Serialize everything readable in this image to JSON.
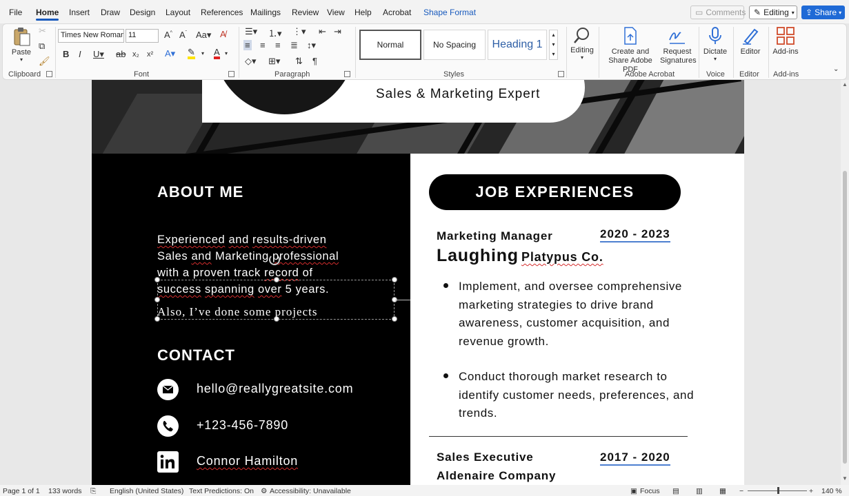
{
  "menu": {
    "tabs": [
      "File",
      "Home",
      "Insert",
      "Draw",
      "Design",
      "Layout",
      "References",
      "Mailings",
      "Review",
      "View",
      "Help",
      "Acrobat",
      "Shape Format"
    ],
    "active_tab": "Home",
    "comments_label": "Comments",
    "editing_label": "Editing",
    "share_label": "Share"
  },
  "ribbon": {
    "clipboard": {
      "paste_label": "Paste",
      "group_label": "Clipboard"
    },
    "font": {
      "font_name": "Times New Roman",
      "font_size": "11",
      "group_label": "Font"
    },
    "paragraph": {
      "group_label": "Paragraph"
    },
    "styles": {
      "normal": "Normal",
      "no_spacing": "No Spacing",
      "heading1": "Heading 1",
      "group_label": "Styles"
    },
    "editing_label": "Editing",
    "acrobat": {
      "create_share": "Create and Share Adobe PDF",
      "request_signatures": "Request Signatures",
      "group_label": "Adobe Acrobat"
    },
    "voice": {
      "dictate": "Dictate",
      "group_label": "Voice"
    },
    "editor": {
      "editor": "Editor",
      "group_label": "Editor"
    },
    "addins": {
      "addins": "Add-ins",
      "group_label": "Add-ins"
    }
  },
  "resume": {
    "subtitle": "Sales & Marketing Expert",
    "about_title": "ABOUT ME",
    "about_words": [
      "Experienced",
      "and",
      "results-driven",
      "Sales",
      "and",
      "Marketing",
      "professional",
      "with a proven track",
      "record",
      "of",
      "success",
      "spanning",
      "over",
      "5 years."
    ],
    "about_lines": [
      "Experienced and results-driven",
      "Sales and Marketing professional",
      "with a proven track record of",
      "success spanning over 5 years."
    ],
    "also_text": "Also, I’ve done some projects",
    "contact_title": "CONTACT",
    "email": "hello@reallygreatsite.com",
    "phone": "+123-456-7890",
    "linkedin": "Connor Hamilton",
    "job_title": "JOB EXPERIENCES",
    "jobs": [
      {
        "role": "Marketing Manager",
        "years": "2020 - 2023",
        "company_big": "Laughing",
        "company_rest": "Platypus Co.",
        "bullets": [
          "Implement, and oversee comprehensive marketing strategies to drive brand awareness, customer acquisition, and revenue growth.",
          "Conduct thorough market research to identify customer needs, preferences, and trends."
        ]
      },
      {
        "role": "Sales Executive",
        "years": "2017 - 2020",
        "company_big": "Aldenaire Company",
        "company_rest": ""
      }
    ]
  },
  "status": {
    "page": "Page 1 of 1",
    "words": "133 words",
    "language": "English (United States)",
    "text_predictions": "Text Predictions: On",
    "accessibility": "Accessibility: Unavailable",
    "focus": "Focus",
    "zoom": "140 %"
  },
  "colors": {
    "accent": "#185abd",
    "share": "#1f6ad6",
    "year_underline": "#4d7fd0",
    "spell_squiggle": "#d62d2d"
  }
}
